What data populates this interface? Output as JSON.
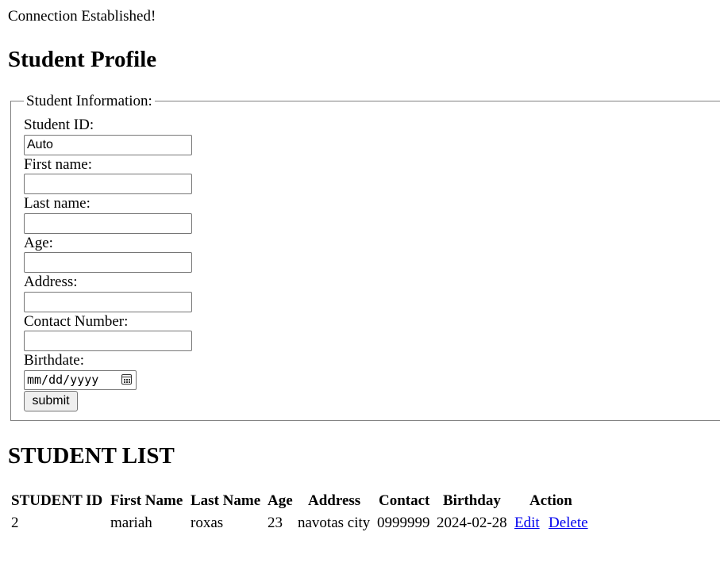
{
  "status_message": "Connection Established!",
  "page_title": "Student Profile",
  "form": {
    "legend": "Student Information:",
    "student_id": {
      "label": "Student ID:",
      "value": "Auto"
    },
    "first_name": {
      "label": "First name:",
      "value": ""
    },
    "last_name": {
      "label": "Last name:",
      "value": ""
    },
    "age": {
      "label": "Age:",
      "value": ""
    },
    "address": {
      "label": "Address:",
      "value": ""
    },
    "contact_number": {
      "label": "Contact Number:",
      "value": ""
    },
    "birthdate": {
      "label": "Birthdate:",
      "placeholder": "mm/dd/yyyy",
      "icon": "calendar-icon"
    },
    "submit_label": "submit"
  },
  "list": {
    "heading": "STUDENT LIST",
    "columns": [
      "STUDENT ID",
      "First Name",
      "Last Name",
      "Age",
      "Address",
      "Contact",
      "Birthday",
      "Action"
    ],
    "rows": [
      {
        "student_id": "2",
        "first_name": "mariah",
        "last_name": "roxas",
        "age": "23",
        "address": "navotas city",
        "contact": "0999999",
        "birthday": "2024-02-28",
        "edit_label": "Edit",
        "delete_label": "Delete"
      }
    ]
  },
  "colors": {
    "link": "#0000ee",
    "fieldset_border": "#808080",
    "button_bg": "#efefef"
  }
}
